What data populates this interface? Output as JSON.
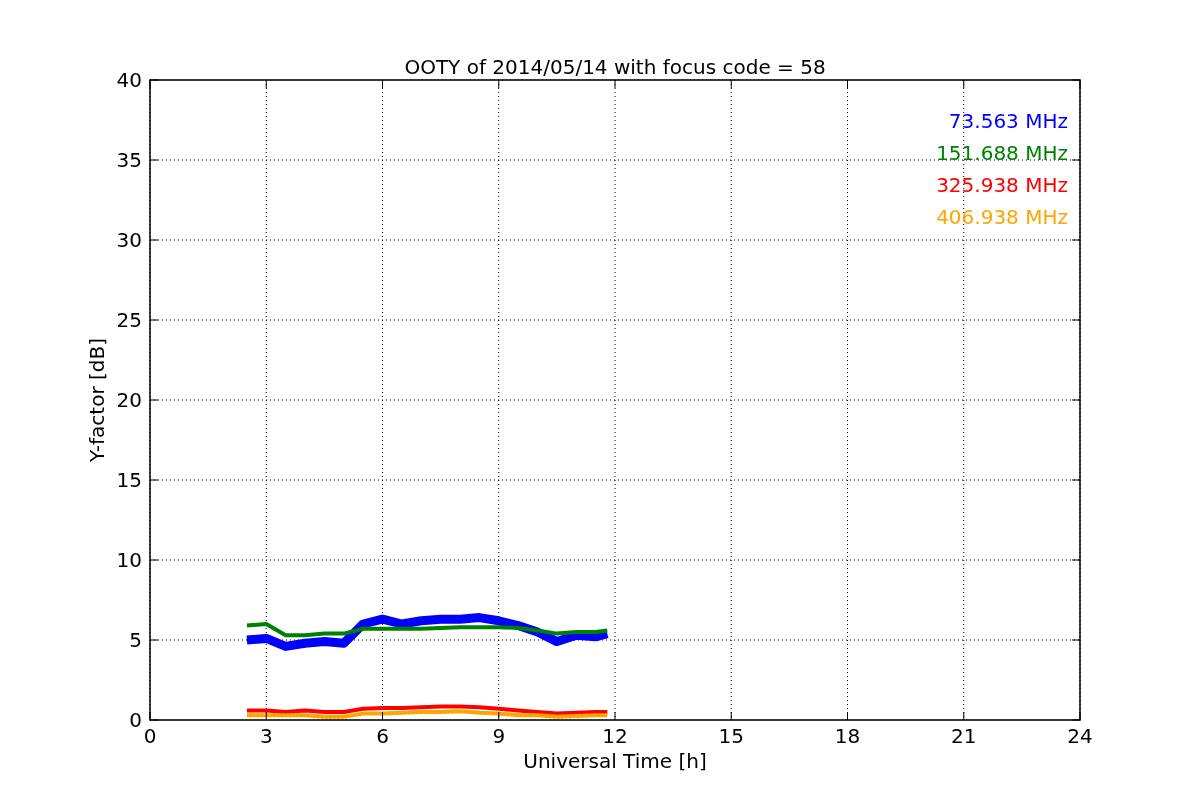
{
  "figure": {
    "chart_data": {
      "type": "line",
      "title": "OOTY of 2014/05/14 with focus code = 58",
      "xlabel": "Universal Time [h]",
      "ylabel": "Y-factor [dB]",
      "x": [
        2.5,
        3,
        3.5,
        4,
        4.5,
        5,
        5.5,
        6,
        6.5,
        7,
        7.5,
        8,
        8.5,
        9,
        9.5,
        10,
        10.5,
        11,
        11.5,
        11.8
      ],
      "series": [
        {
          "name": "73.563 MHz",
          "color": "#0000ff",
          "values": [
            5.0,
            5.1,
            4.6,
            4.8,
            4.9,
            4.8,
            6.0,
            6.3,
            6.0,
            6.2,
            6.3,
            6.3,
            6.4,
            6.2,
            5.9,
            5.5,
            4.9,
            5.3,
            5.2,
            5.4
          ]
        },
        {
          "name": "151.688 MHz",
          "color": "#008000",
          "values": [
            5.9,
            6.0,
            5.3,
            5.3,
            5.4,
            5.4,
            5.7,
            5.7,
            5.7,
            5.7,
            5.75,
            5.8,
            5.8,
            5.8,
            5.75,
            5.6,
            5.4,
            5.5,
            5.5,
            5.6
          ]
        },
        {
          "name": "325.938 MHz",
          "color": "#ff0000",
          "values": [
            0.6,
            0.6,
            0.5,
            0.6,
            0.5,
            0.5,
            0.7,
            0.75,
            0.75,
            0.8,
            0.85,
            0.85,
            0.8,
            0.7,
            0.6,
            0.5,
            0.4,
            0.45,
            0.5,
            0.5
          ]
        },
        {
          "name": "406.938 MHz",
          "color": "#ffa500",
          "values": [
            0.3,
            0.3,
            0.3,
            0.3,
            0.2,
            0.2,
            0.4,
            0.4,
            0.45,
            0.5,
            0.5,
            0.55,
            0.45,
            0.4,
            0.3,
            0.3,
            0.2,
            0.25,
            0.3,
            0.3
          ]
        }
      ],
      "xlim": [
        0,
        24
      ],
      "ylim": [
        0,
        40
      ],
      "xticks": [
        0,
        3,
        6,
        9,
        12,
        15,
        18,
        21,
        24
      ],
      "yticks": [
        0,
        5,
        10,
        15,
        20,
        25,
        30,
        35,
        40
      ],
      "grid": true
    }
  }
}
